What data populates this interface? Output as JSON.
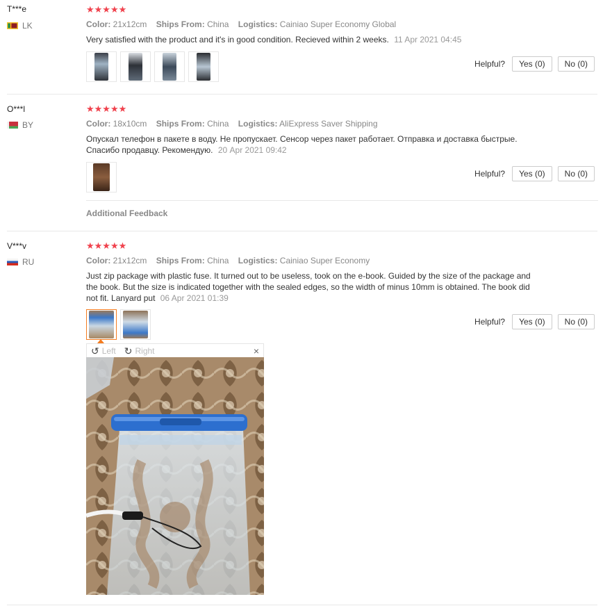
{
  "labels": {
    "color": "Color:",
    "ships_from": "Ships From:",
    "logistics": "Logistics:",
    "helpful": "Helpful?",
    "additional_feedback": "Additional Feedback"
  },
  "reviews": [
    {
      "name": "T***e",
      "country": "LK",
      "stars": "★★★★★",
      "color": "21x12cm",
      "ships_from": "China",
      "logistics": "Cainiao Super Economy Global",
      "text": "Very satisfied with the product and it's in good condition. Recieved within 2 weeks.",
      "date": "11 Apr 2021 04:45",
      "yes": "Yes (0)",
      "no": "No (0)",
      "thumb_count": 4
    },
    {
      "name": "O***l",
      "country": "BY",
      "stars": "★★★★★",
      "color": "18x10cm",
      "ships_from": "China",
      "logistics": "AliExpress Saver Shipping",
      "text": "Опускал телефон в пакете в воду. Не пропускает. Сенсор через пакет работает. Отправка и доставка быстрые. Спасибо продавцу. Рекомендую.",
      "date": "20 Apr 2021 09:42",
      "yes": "Yes (0)",
      "no": "No (0)",
      "thumb_count": 1
    },
    {
      "name": "V***v",
      "country": "RU",
      "stars": "★★★★★",
      "color": "21x12cm",
      "ships_from": "China",
      "logistics": "Cainiao Super Economy",
      "text": "Just zip package with plastic fuse. It turned out to be useless, took on the e-book. Guided by the size of the package and the book. But the size is indicated together with the sealed edges, so the width of minus 10mm is obtained. The book did not fit. Lanyard put",
      "date": "06 Apr 2021 01:39",
      "yes": "Yes (0)",
      "no": "No (0)",
      "thumb_count": 2
    }
  ],
  "viewer": {
    "left_label": "Left",
    "right_label": "Right",
    "close_glyph": "×",
    "rotate_left_glyph": "↺",
    "rotate_right_glyph": "↻"
  },
  "colors": {
    "star": "#f0424d",
    "active_thumb": "#f47c20",
    "muted_text": "#888888"
  }
}
